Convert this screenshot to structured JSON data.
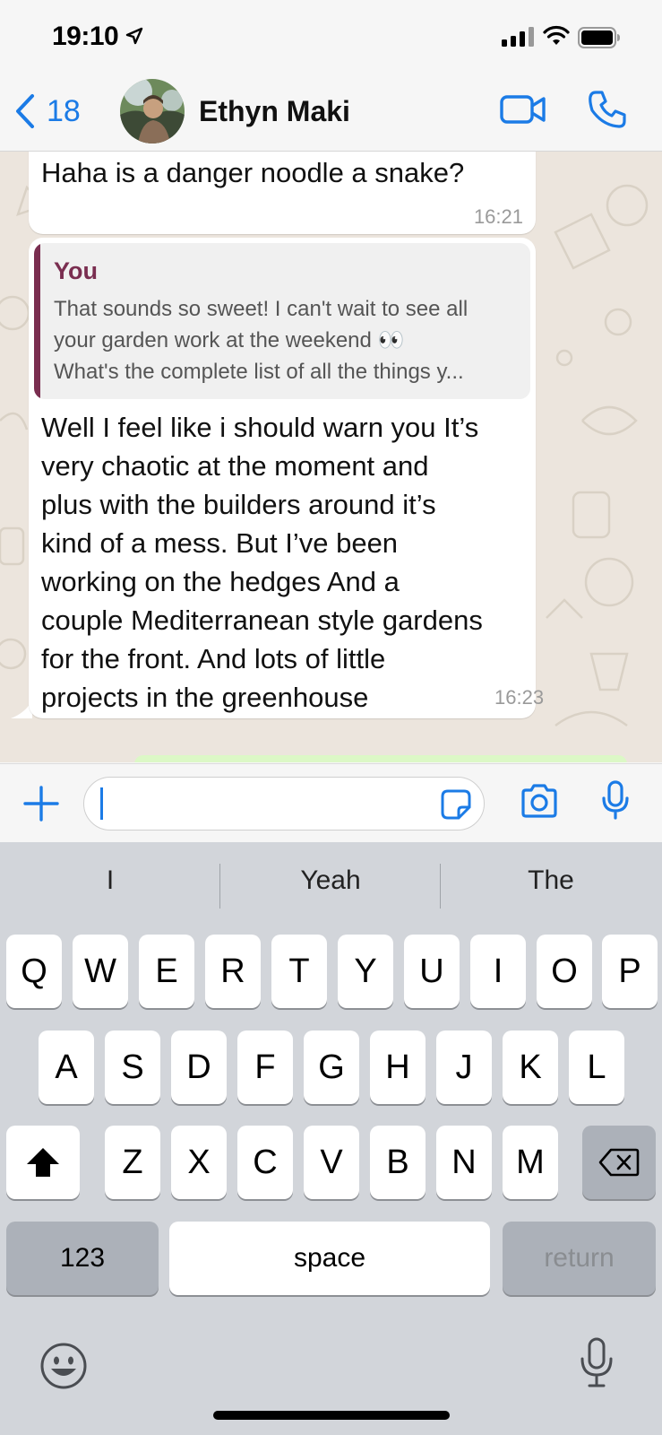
{
  "status_bar": {
    "time": "19:10"
  },
  "header": {
    "back_count": "18",
    "contact_name": "Ethyn Maki"
  },
  "messages": [
    {
      "text": "Haha is a danger noodle a snake?",
      "time": "16:21"
    },
    {
      "quoted": {
        "author": "You",
        "lines": [
          "That sounds so sweet! I can't wait to see all",
          "your garden work at the weekend 👀",
          "What's the complete list of all the things y..."
        ]
      },
      "lines": [
        "Well I feel like i should warn you It’s",
        "very chaotic at the moment and",
        "plus with the builders around it’s",
        "kind of a mess. But I’ve been",
        "working on the hedges And a",
        "couple Mediterranean style gardens",
        "for the front. And lots of little",
        "projects in the greenhouse"
      ],
      "time": "16:23"
    }
  ],
  "input": {
    "value": ""
  },
  "keyboard": {
    "suggestions": [
      "I",
      "Yeah",
      "The"
    ],
    "row1": [
      "Q",
      "W",
      "E",
      "R",
      "T",
      "Y",
      "U",
      "I",
      "O",
      "P"
    ],
    "row2": [
      "A",
      "S",
      "D",
      "F",
      "G",
      "H",
      "J",
      "K",
      "L"
    ],
    "row3": [
      "Z",
      "X",
      "C",
      "V",
      "B",
      "N",
      "M"
    ],
    "numbers_label": "123",
    "space_label": "space",
    "return_label": "return"
  },
  "colors": {
    "accent": "#1b7be6",
    "quote_author": "#7a2e50",
    "chat_bg": "#ece5dd",
    "keyboard_bg": "#d2d5da"
  }
}
